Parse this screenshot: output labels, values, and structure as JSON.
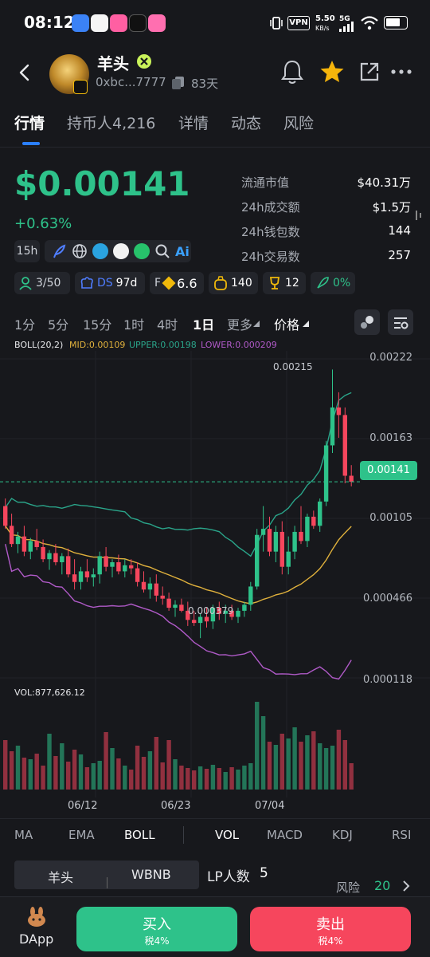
{
  "status": {
    "time": "08:12",
    "vpn": "VPN",
    "speed_value": "5.50",
    "speed_unit": "KB/s",
    "network": "5G"
  },
  "header": {
    "token_name": "羊头",
    "address": "0xbc...7777",
    "age": "83天"
  },
  "tabs": [
    {
      "label": "行情",
      "active": true
    },
    {
      "label": "持币人4,216",
      "active": false
    },
    {
      "label": "详情",
      "active": false
    },
    {
      "label": "动态",
      "active": false
    },
    {
      "label": "风险",
      "active": false
    }
  ],
  "price": {
    "value": "$0.00141",
    "change": "+0.63%",
    "age_chip": "15h"
  },
  "stats": [
    {
      "label": "流通市值",
      "value": "$40.31万"
    },
    {
      "label": "24h成交额",
      "value": "$1.5万"
    },
    {
      "label": "24h钱包数",
      "value": "144"
    },
    {
      "label": "24h交易数",
      "value": "257"
    }
  ],
  "metrics": {
    "holders": "3/50",
    "ds_label": "DS",
    "ds_value": "97d",
    "f_label": "F",
    "f_value": "6.6",
    "bag": "140",
    "trophy": "12",
    "rocket": "0%"
  },
  "intervals": [
    "1分",
    "5分",
    "15分",
    "1时",
    "4时",
    "1日",
    "更多",
    "价格"
  ],
  "boll": {
    "label": "BOLL(20,2)",
    "mid": "MID:0.00109",
    "upper": "UPPER:0.00198",
    "lower": "LOWER:0.000209"
  },
  "colors": {
    "up": "#2ec28a",
    "down": "#f6465d",
    "mid": "#e0b13c",
    "upper": "#2aa58a",
    "lower": "#b05ac8"
  },
  "chart_data": {
    "type": "candlestick",
    "x": [
      "06/12",
      "06/23",
      "07/04"
    ],
    "y_ticks": [
      "0.00222",
      "0.00163",
      "0.00105",
      "0.000466",
      "0.000118"
    ],
    "last_price": "0.00141",
    "high_label": "0.00215",
    "low_label": "0.000379",
    "volume_label": "VOL:877,626.12",
    "candles": [
      [
        0.00125,
        0.0013,
        0.0011,
        0.00112
      ],
      [
        0.00112,
        0.0012,
        0.00098,
        0.001
      ],
      [
        0.001,
        0.00108,
        0.00094,
        0.00105
      ],
      [
        0.00105,
        0.00112,
        0.00092,
        0.00095
      ],
      [
        0.00095,
        0.00104,
        0.0009,
        0.00102
      ],
      [
        0.00102,
        0.0011,
        0.00096,
        0.00098
      ],
      [
        0.00098,
        0.00103,
        0.00088,
        0.0009
      ],
      [
        0.0009,
        0.00096,
        0.00083,
        0.00094
      ],
      [
        0.00094,
        0.001,
        0.00086,
        0.00088
      ],
      [
        0.00088,
        0.00094,
        0.0008,
        0.00092
      ],
      [
        0.00092,
        0.00097,
        0.00078,
        0.0008
      ],
      [
        0.0008,
        0.0009,
        0.0007,
        0.00075
      ],
      [
        0.00075,
        0.00085,
        0.0007,
        0.00082
      ],
      [
        0.00082,
        0.0009,
        0.00075,
        0.00078
      ],
      [
        0.00078,
        0.00084,
        0.00072,
        0.0008
      ],
      [
        0.0008,
        0.00095,
        0.00074,
        0.00092
      ],
      [
        0.00092,
        0.00098,
        0.00082,
        0.00085
      ],
      [
        0.00085,
        0.0009,
        0.00078,
        0.00088
      ],
      [
        0.00088,
        0.00093,
        0.0008,
        0.00082
      ],
      [
        0.00082,
        0.0009,
        0.00078,
        0.00086
      ],
      [
        0.00086,
        0.0009,
        0.0008,
        0.00084
      ],
      [
        0.00084,
        0.00088,
        0.00072,
        0.00075
      ],
      [
        0.00075,
        0.00082,
        0.00068,
        0.0007
      ],
      [
        0.0007,
        0.00078,
        0.00064,
        0.00074
      ],
      [
        0.00074,
        0.0008,
        0.00062,
        0.00066
      ],
      [
        0.00066,
        0.00072,
        0.0006,
        0.00064
      ],
      [
        0.00064,
        0.00068,
        0.00056,
        0.00058
      ],
      [
        0.00058,
        0.00063,
        0.00052,
        0.0006
      ],
      [
        0.0006,
        0.00064,
        0.00055,
        0.00056
      ],
      [
        0.00056,
        0.00062,
        0.00046,
        0.0005
      ],
      [
        0.0005,
        0.00056,
        0.00046,
        0.00048
      ],
      [
        0.00048,
        0.00054,
        0.00038,
        0.00052
      ],
      [
        0.00052,
        0.00058,
        0.00045,
        0.00049
      ],
      [
        0.00049,
        0.0006,
        0.00044,
        0.00058
      ],
      [
        0.00058,
        0.00062,
        0.0005,
        0.00054
      ],
      [
        0.00054,
        0.0006,
        0.00048,
        0.00056
      ],
      [
        0.00056,
        0.0006,
        0.0005,
        0.00052
      ],
      [
        0.00052,
        0.00058,
        0.00048,
        0.00056
      ],
      [
        0.00056,
        0.00062,
        0.00052,
        0.0006
      ],
      [
        0.0006,
        0.00075,
        0.00056,
        0.00072
      ],
      [
        0.00072,
        0.0011,
        0.0007,
        0.00106
      ],
      [
        0.00106,
        0.00125,
        0.00095,
        0.0011
      ],
      [
        0.0011,
        0.00118,
        0.00092,
        0.00095
      ],
      [
        0.00095,
        0.00112,
        0.00088,
        0.00108
      ],
      [
        0.00108,
        0.00115,
        0.0008,
        0.00085
      ],
      [
        0.00085,
        0.00105,
        0.0008,
        0.00095
      ],
      [
        0.00095,
        0.00112,
        0.0009,
        0.00108
      ],
      [
        0.00108,
        0.00125,
        0.001,
        0.00102
      ],
      [
        0.00102,
        0.0012,
        0.00098,
        0.00118
      ],
      [
        0.00118,
        0.00122,
        0.0011,
        0.00112
      ],
      [
        0.00112,
        0.0013,
        0.00108,
        0.00128
      ],
      [
        0.00128,
        0.00168,
        0.00125,
        0.00165
      ],
      [
        0.00165,
        0.00215,
        0.0016,
        0.0019
      ],
      [
        0.0019,
        0.002,
        0.0017,
        0.00185
      ],
      [
        0.00185,
        0.0019,
        0.0014,
        0.00145
      ],
      [
        0.00145,
        0.00152,
        0.00138,
        0.00141
      ]
    ],
    "volumes": [
      62,
      48,
      55,
      40,
      38,
      45,
      30,
      70,
      42,
      58,
      35,
      50,
      44,
      28,
      33,
      36,
      72,
      52,
      39,
      30,
      25,
      55,
      41,
      48,
      66,
      34,
      62,
      38,
      30,
      27,
      24,
      29,
      26,
      31,
      27,
      22,
      28,
      25,
      30,
      33,
      110,
      92,
      60,
      56,
      70,
      64,
      78,
      60,
      68,
      73,
      58,
      52,
      55,
      75,
      62,
      33
    ]
  },
  "indicators": {
    "left": [
      "MA",
      "EMA",
      "BOLL"
    ],
    "right": [
      "VOL",
      "MACD",
      "KDJ",
      "RSI"
    ],
    "active_left": "BOLL",
    "active_right": "VOL"
  },
  "bottom": {
    "pair_left": "羊头",
    "pair_right": "WBNB",
    "lp_label": "LP人数",
    "lp_value": "5",
    "risk_label": "风险",
    "risk_value": "20",
    "dapp_label": "DApp",
    "buy_label": "买入",
    "buy_tax": "税4%",
    "sell_label": "卖出",
    "sell_tax": "税4%"
  }
}
